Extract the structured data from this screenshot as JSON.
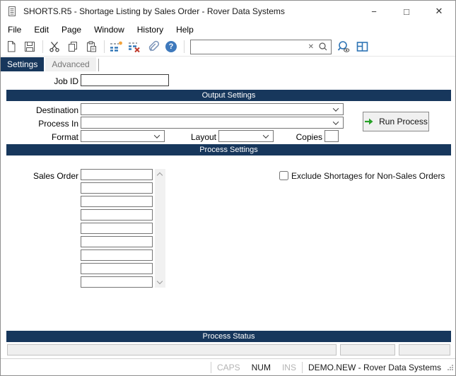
{
  "window": {
    "title": "SHORTS.R5 - Shortage Listing by Sales Order - Rover Data Systems",
    "minimize_glyph": "−",
    "maximize_glyph": "□",
    "close_glyph": "✕"
  },
  "menu": {
    "items": [
      "File",
      "Edit",
      "Page",
      "Window",
      "History",
      "Help"
    ]
  },
  "toolbar": {
    "search_value": "",
    "clear_glyph": "✕",
    "icons": [
      "new-document",
      "save",
      "cut",
      "copy",
      "paste",
      "insert-rows",
      "delete-rows",
      "attachment",
      "help",
      "record-search",
      "form-view"
    ]
  },
  "tabs": {
    "settings": "Settings",
    "advanced": "Advanced"
  },
  "form": {
    "job_id_label": "Job ID",
    "job_id_value": "",
    "output": {
      "header": "Output Settings",
      "destination_label": "Destination",
      "destination_value": "",
      "process_in_label": "Process In",
      "process_in_value": "",
      "format_label": "Format",
      "format_value": "",
      "layout_label": "Layout",
      "layout_value": "",
      "copies_label": "Copies",
      "copies_value": "",
      "run_button_label": "Run Process"
    },
    "process": {
      "header": "Process Settings",
      "sales_order_label": "Sales Order",
      "sales_order_values": [
        "",
        "",
        "",
        "",
        "",
        "",
        "",
        "",
        ""
      ],
      "exclude_label": "Exclude Shortages for Non-Sales Orders",
      "exclude_checked": false
    },
    "status": {
      "header": "Process Status",
      "fields": [
        "",
        "",
        ""
      ]
    }
  },
  "status_bar": {
    "caps_label": "CAPS",
    "num_label": "NUM",
    "ins_label": "INS",
    "caps_active": false,
    "num_active": true,
    "ins_active": false,
    "session_label": "DEMO.NEW - Rover Data Systems"
  },
  "colors": {
    "navy": "#17375C",
    "accent_blue": "#2E74B5",
    "green": "#27A127",
    "orange": "#F2A33C",
    "red": "#C0392B",
    "help_blue": "#3E79BC"
  }
}
